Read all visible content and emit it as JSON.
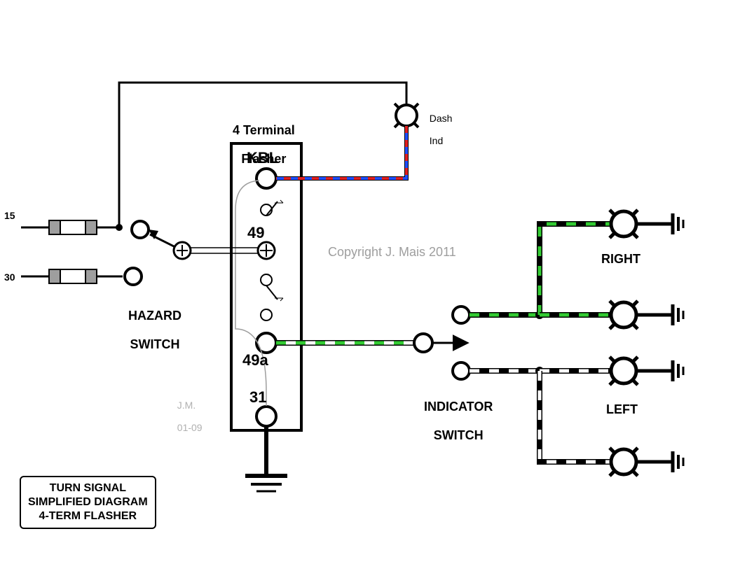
{
  "title_box": {
    "line1": "TURN SIGNAL",
    "line2": "SIMPLIFIED DIAGRAM",
    "line3": "4-TERM FLASHER"
  },
  "flasher": {
    "heading_line1": "4 Terminal",
    "heading_line2": "Flasher",
    "term_kbl": "KBL",
    "term_49": "49",
    "term_49a": "49a",
    "term_31": "31"
  },
  "inputs": {
    "fuse15": "15",
    "fuse30": "30"
  },
  "switches": {
    "hazard_line1": "HAZARD",
    "hazard_line2": "SWITCH",
    "indicator_line1": "INDICATOR",
    "indicator_line2": "SWITCH"
  },
  "lamps": {
    "dash_line1": "Dash",
    "dash_line2": "Ind",
    "right": "RIGHT",
    "left": "LEFT"
  },
  "meta": {
    "copyright": "Copyright J. Mais 2011",
    "author": "J.M.",
    "date": "01-09"
  },
  "colors": {
    "green": "#33cc33",
    "blue": "#1e4fff",
    "red": "#e02020",
    "gray": "#9e9e9e"
  }
}
